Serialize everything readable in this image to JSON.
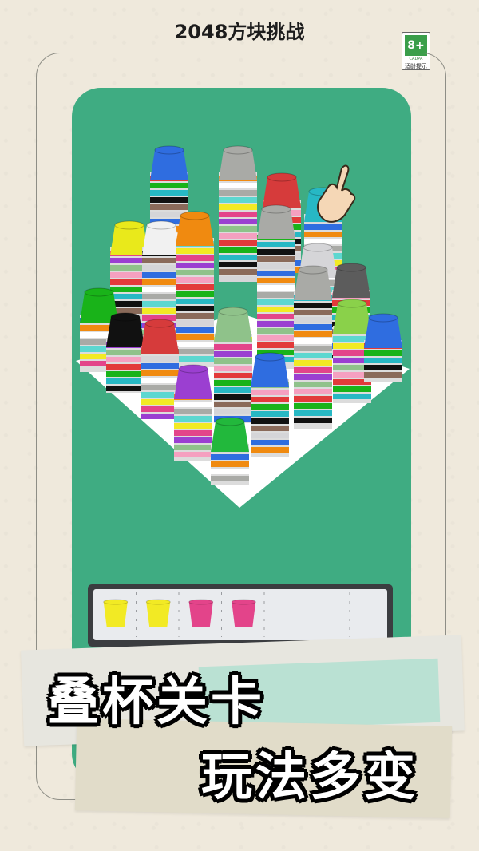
{
  "title": "2048方块挑战",
  "age_rating": {
    "label": "8+",
    "org": "CADPA",
    "hint": "适龄提示"
  },
  "slogan": {
    "line1": "叠杯关卡",
    "line2": "玩法多变"
  },
  "colors": {
    "background": "#efe9dc",
    "game_bg": "#3fac82",
    "tray_bg": "#3b3d40",
    "tray_inner": "#e9ebee",
    "slogan_text": "#ffffff",
    "slogan_outline": "#000000"
  },
  "tray": {
    "slot_count": 7,
    "cups": [
      {
        "color": "#f2ea24"
      },
      {
        "color": "#f2ea24"
      },
      {
        "color": "#e3448a"
      },
      {
        "color": "#e3448a"
      }
    ]
  },
  "board": {
    "stacks": [
      {
        "cap": "#2f6de0"
      },
      {
        "cap": "#a9aaa6"
      },
      {
        "cap": "#d63b3b"
      },
      {
        "cap": "#27b8c4"
      },
      {
        "cap": "#e9e91b"
      },
      {
        "cap": "#f1f1f1"
      },
      {
        "cap": "#f08a10"
      },
      {
        "cap": "#a9aaa6"
      },
      {
        "cap": "#d5d5d8"
      },
      {
        "cap": "#5c5c5c"
      },
      {
        "cap": "#19b319"
      },
      {
        "cap": "#111111"
      },
      {
        "cap": "#d63b3b"
      },
      {
        "cap": "#8fc28a"
      },
      {
        "cap": "#a9aaa6"
      },
      {
        "cap": "#8ad14a"
      },
      {
        "cap": "#2f6de0"
      },
      {
        "cap": "#9b3fd1"
      },
      {
        "cap": "#2f6de0"
      },
      {
        "cap": "#22b83c"
      }
    ]
  },
  "icons": {
    "hand": "pointing-hand-icon",
    "undo": "undo-icon",
    "plus": "plus-icon"
  }
}
